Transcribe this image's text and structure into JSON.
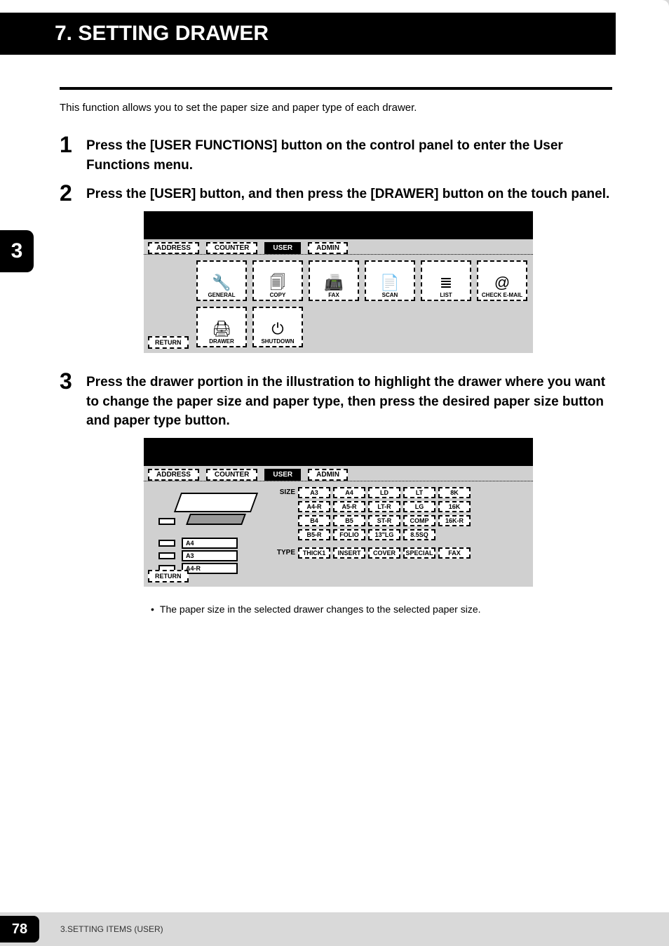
{
  "header": {
    "title": "7. SETTING DRAWER"
  },
  "intro": "This function allows you to set the paper size and paper type of each drawer.",
  "chapter_tab": "3",
  "steps": [
    {
      "num": "1",
      "text": "Press the [USER FUNCTIONS] button on the control panel to enter the User Functions menu."
    },
    {
      "num": "2",
      "text": "Press the [USER] button, and then press the [DRAWER] button on the touch panel."
    },
    {
      "num": "3",
      "text": "Press the drawer portion in the illustration to highlight the drawer where you want to change the paper size and paper type, then press the desired paper size button and paper type button."
    }
  ],
  "panel1": {
    "tabs": [
      "ADDRESS",
      "COUNTER",
      "USER",
      "ADMIN"
    ],
    "active_tab": "USER",
    "icons": [
      {
        "label": "GENERAL"
      },
      {
        "label": "COPY"
      },
      {
        "label": "FAX"
      },
      {
        "label": "SCAN"
      },
      {
        "label": "LIST"
      },
      {
        "label": "CHECK E-MAIL"
      },
      {
        "label": "DRAWER"
      },
      {
        "label": "SHUTDOWN"
      }
    ],
    "return": "RETURN"
  },
  "panel2": {
    "tabs": [
      "ADDRESS",
      "COUNTER",
      "USER",
      "ADMIN"
    ],
    "active_tab": "USER",
    "drawer_labels": [
      "A4",
      "A3",
      "A4-R"
    ],
    "size_label": "SIZE",
    "type_label": "TYPE",
    "size_rows": [
      [
        "A3",
        "A4",
        "LD",
        "LT",
        "8K"
      ],
      [
        "A4-R",
        "A5-R",
        "LT-R",
        "LG",
        "16K"
      ],
      [
        "B4",
        "B5",
        "ST-R",
        "COMP",
        "16K-R"
      ],
      [
        "B5-R",
        "FOLIO",
        "13\"LG",
        "8.5SQ"
      ]
    ],
    "type_row": [
      "THICK1",
      "INSERT",
      "COVER",
      "SPECIAL",
      "FAX"
    ],
    "return": "RETURN"
  },
  "note": "The paper size in the selected drawer changes to the selected paper size.",
  "footer": {
    "page_number": "78",
    "section": "3.SETTING ITEMS (USER)"
  }
}
